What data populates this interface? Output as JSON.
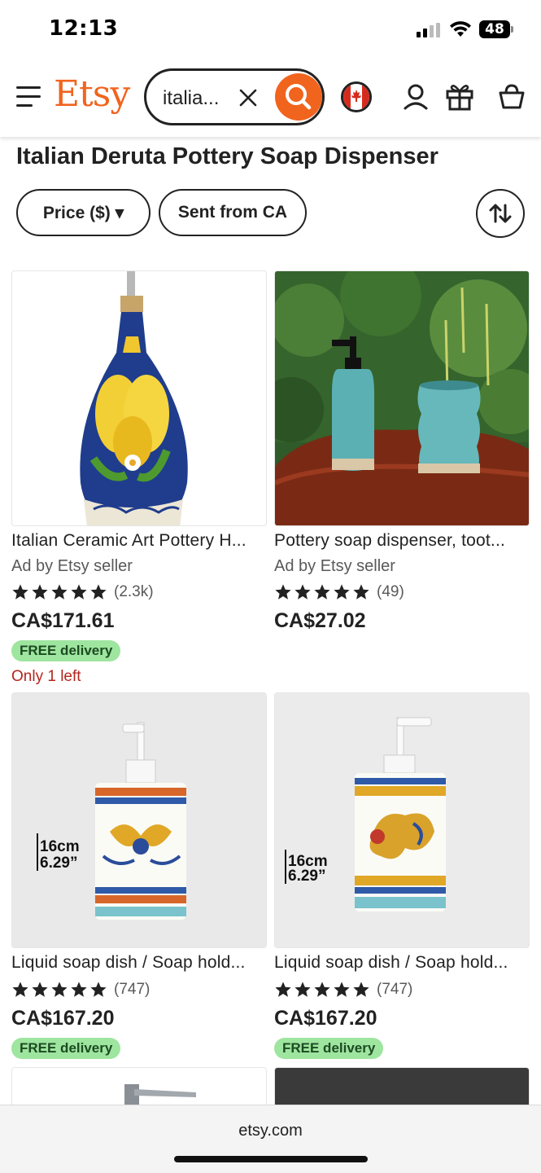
{
  "status_bar": {
    "time": "12:13",
    "battery": "48"
  },
  "header": {
    "logo": "Etsy",
    "search_value": "italia...",
    "accent": "#f1641e"
  },
  "page_title": "Italian Deruta Pottery Soap Dispenser",
  "filters": [
    {
      "label": "Price ($) ▾"
    },
    {
      "label": "Sent from CA"
    }
  ],
  "listings": [
    {
      "title": "Italian Ceramic Art Pottery H...",
      "ad_label": "Ad by Etsy seller",
      "rating": 5,
      "reviews": "(2.3k)",
      "price": "CA$171.61",
      "badge": "FREE delivery",
      "stock": "Only 1 left"
    },
    {
      "title": "Pottery soap dispenser, toot...",
      "ad_label": "Ad by Etsy seller",
      "rating": 5,
      "reviews": "(49)",
      "price": "CA$27.02"
    },
    {
      "title": "Liquid soap dish / Soap hold...",
      "rating": 5,
      "reviews": "(747)",
      "price": "CA$167.20",
      "badge": "FREE delivery",
      "image_caption": [
        "16cm",
        "6.29”"
      ]
    },
    {
      "title": "Liquid soap dish / Soap hold...",
      "rating": 5,
      "reviews": "(747)",
      "price": "CA$167.20",
      "badge": "FREE delivery",
      "image_caption": [
        "16cm",
        "6.29”"
      ]
    }
  ],
  "browser": {
    "url": "etsy.com"
  }
}
